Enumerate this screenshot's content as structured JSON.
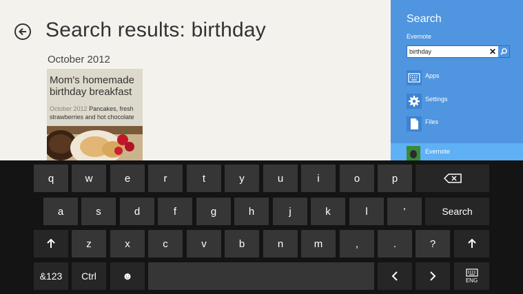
{
  "app": {
    "title": "Search results: birthday",
    "group_header": "October 2012",
    "result": {
      "title": "Mom's homemade birthday breakfast",
      "date": "October 2012",
      "snippet": "Pancakes, fresh strawberries and hot chocolate"
    }
  },
  "search_pane": {
    "title": "Search",
    "scope": "Evernote",
    "query": "birthday",
    "clear_glyph": "✕",
    "items": [
      {
        "label": "Apps",
        "icon": "keyboard-icon"
      },
      {
        "label": "Settings",
        "icon": "gear-icon"
      },
      {
        "label": "Files",
        "icon": "file-icon"
      }
    ],
    "selected_app": "Evernote"
  },
  "keyboard": {
    "row1": [
      "q",
      "w",
      "e",
      "r",
      "t",
      "y",
      "u",
      "i",
      "o",
      "p"
    ],
    "row2": [
      "a",
      "s",
      "d",
      "f",
      "g",
      "h",
      "j",
      "k",
      "l",
      "'"
    ],
    "row2_action": "Search",
    "row3": [
      "z",
      "x",
      "c",
      "v",
      "b",
      "n",
      "m",
      ",",
      ".",
      "?"
    ],
    "shift_glyph": "🡅",
    "row4": {
      "symbols": "&123",
      "ctrl": "Ctrl",
      "emoji": "☻",
      "left": "<",
      "right": ">",
      "lang": "ENG"
    }
  }
}
